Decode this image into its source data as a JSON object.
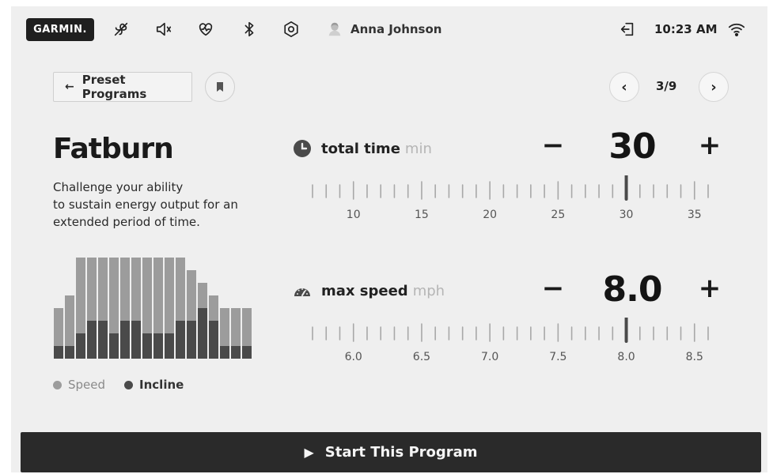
{
  "status_bar": {
    "brand": "GARMIN.",
    "icons": [
      "fan-off-icon",
      "volume-icon",
      "heart-rate-icon",
      "bluetooth-icon",
      "settings-icon"
    ],
    "user_name": "Anna Johnson",
    "time": "10:23 AM",
    "logout_icon": "logout-icon",
    "wifi_icon": "wifi-icon"
  },
  "nav": {
    "back_label": "Preset Programs",
    "page": "3/9"
  },
  "program": {
    "title": "Fatburn",
    "description_lines": [
      "Challenge your ability",
      "to sustain energy output for an",
      "extended period of time."
    ],
    "profile": {
      "speed": [
        4,
        5,
        8,
        8,
        8,
        8,
        8,
        8,
        8,
        8,
        8,
        8,
        7,
        6,
        5,
        4,
        4,
        4
      ],
      "incline": [
        1,
        1,
        2,
        3,
        3,
        2,
        3,
        3,
        2,
        2,
        2,
        3,
        3,
        4,
        3,
        1,
        1,
        1
      ],
      "speed_color": "#9c9c9c",
      "incline_color": "#4a4a4a"
    },
    "legend": {
      "speed": "Speed",
      "incline": "Incline"
    }
  },
  "params": {
    "time": {
      "label": "total time",
      "unit": "min",
      "value": "30",
      "ticks": [
        "10",
        "15",
        "20",
        "25",
        "30",
        "35"
      ],
      "min": 7,
      "max": 36,
      "current": 30,
      "step": 1
    },
    "speed": {
      "label": "max speed",
      "unit": "mph",
      "value": "8.0",
      "ticks": [
        "6.0",
        "6.5",
        "7.0",
        "7.5",
        "8.0",
        "8.5"
      ],
      "min": 5.7,
      "max": 8.6,
      "current": 8.0,
      "step": 0.1
    }
  },
  "start_button": {
    "label": "Start This Program"
  }
}
